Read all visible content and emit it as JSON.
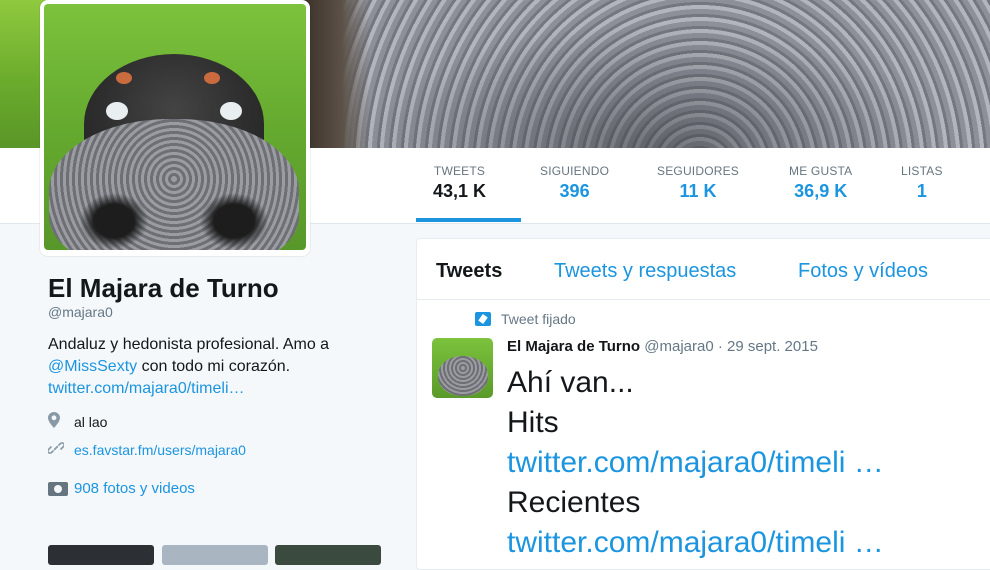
{
  "profile": {
    "name": "El Majara de Turno",
    "handle": "@majara0",
    "bio_text_1": "Andaluz y hedonista profesional. Amo a",
    "bio_mention": "@MissSexty",
    "bio_text_2": " con todo mi corazón.",
    "bio_link": "twitter.com/majara0/timeli…",
    "location": "al lao",
    "website": "es.favstar.fm/users/majara0",
    "photos_label": "908 fotos y videos"
  },
  "stats": [
    {
      "label": "TWEETS",
      "value": "43,1 K"
    },
    {
      "label": "SIGUIENDO",
      "value": "396"
    },
    {
      "label": "SEGUIDORES",
      "value": "11 K"
    },
    {
      "label": "ME GUSTA",
      "value": "36,9 K"
    },
    {
      "label": "LISTAS",
      "value": "1"
    }
  ],
  "timeline": {
    "tabs": [
      "Tweets",
      "Tweets y respuestas",
      "Fotos y vídeos"
    ],
    "pinned_label": "Tweet fijado",
    "tweet": {
      "author": "El Majara de Turno",
      "meta": "@majara0 · 29 sept. 2015",
      "lines": [
        "Ahí van...",
        "Hits",
        "twitter.com/majara0/timeli …",
        "Recientes",
        "twitter.com/majara0/timeli …"
      ]
    }
  },
  "icons": {
    "location": "map-pin-icon",
    "website": "link-icon",
    "photos": "camera-icon",
    "pinned": "pin-icon"
  },
  "colors": {
    "accent": "#1b95e0",
    "text": "#14171a",
    "muted": "#657786"
  }
}
